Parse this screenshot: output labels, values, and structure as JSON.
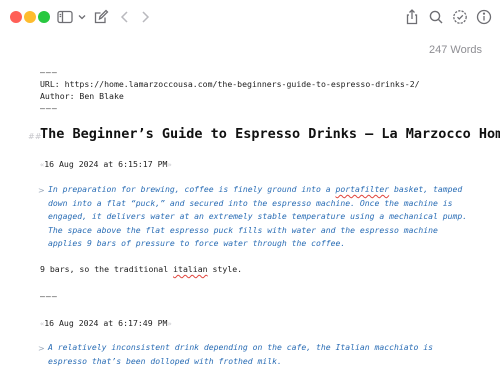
{
  "window": {
    "title": "The Beginner’s Guide to Espresso Drinks – La Marzocco Home"
  },
  "toolbar": {
    "icons": [
      "sidebar-icon",
      "chevron-down-icon",
      "compose-icon",
      "back-arrow-icon",
      "forward-arrow-icon",
      "share-icon",
      "search-icon",
      "badge-icon",
      "info-icon"
    ]
  },
  "editor": {
    "word_count": "247 Words",
    "sep1": "———",
    "url_line": "URL: https://home.lamarzoccousa.com/the-beginners-guide-to-espresso-drinks-2/",
    "author_line": "Author: Ben Blake",
    "sep2": "———",
    "heading_mark": "##",
    "heading": "The Beginner’s Guide to Espresso Drinks – La Marzocco Home",
    "entry1": {
      "timestamp": "16 Aug 2024 at 6:15:17 PM",
      "quote_mark": ">",
      "quote_parts": [
        "In preparation for brewing, coffee is finely ground into a ",
        "portafilter",
        " basket, tamped down into a flat “puck,” and secured into the espresso machine. Once the machine is engaged, it delivers water at an extremely stable temperature using a mechanical pump. The space above the flat espresso puck fills with water and the espresso machine applies 9 bars of pressure to force water through the coffee."
      ],
      "note_parts": [
        "9 bars, so the traditional ",
        "italian",
        " style."
      ]
    },
    "sep3": "———",
    "entry2": {
      "timestamp": "16 Aug 2024 at 6:17:49 PM",
      "quote_mark": ">",
      "quote": "A relatively inconsistent drink depending on the cafe, the Italian macchiato is espresso that’s been dolloped with frothed milk."
    }
  }
}
